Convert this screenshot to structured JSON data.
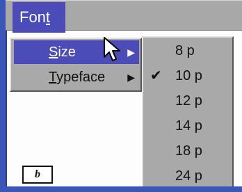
{
  "menubar": {
    "font_menu": {
      "label_before": "Fon",
      "label_underline": "t",
      "label_after": ""
    }
  },
  "submenu_font": {
    "items": [
      {
        "label_before": "",
        "label_underline": "S",
        "label_after": "ize",
        "arrow": "▶",
        "selected": true
      },
      {
        "label_before": "",
        "label_underline": "T",
        "label_after": "ypeface",
        "arrow": "▶",
        "selected": false
      }
    ]
  },
  "submenu_size": {
    "options": [
      {
        "label": "8 p",
        "checked": false
      },
      {
        "label": "10 p",
        "checked": true
      },
      {
        "label": "12 p",
        "checked": false
      },
      {
        "label": "14 p",
        "checked": false
      },
      {
        "label": "18 p",
        "checked": false
      },
      {
        "label": "24 p",
        "checked": false
      }
    ],
    "check_glyph": "✔"
  },
  "preview_box": {
    "label": "b"
  },
  "colors": {
    "menu_highlight": "#4c4cb8",
    "menu_bg": "#a9a9a9",
    "desktop": "#3a56b8"
  }
}
